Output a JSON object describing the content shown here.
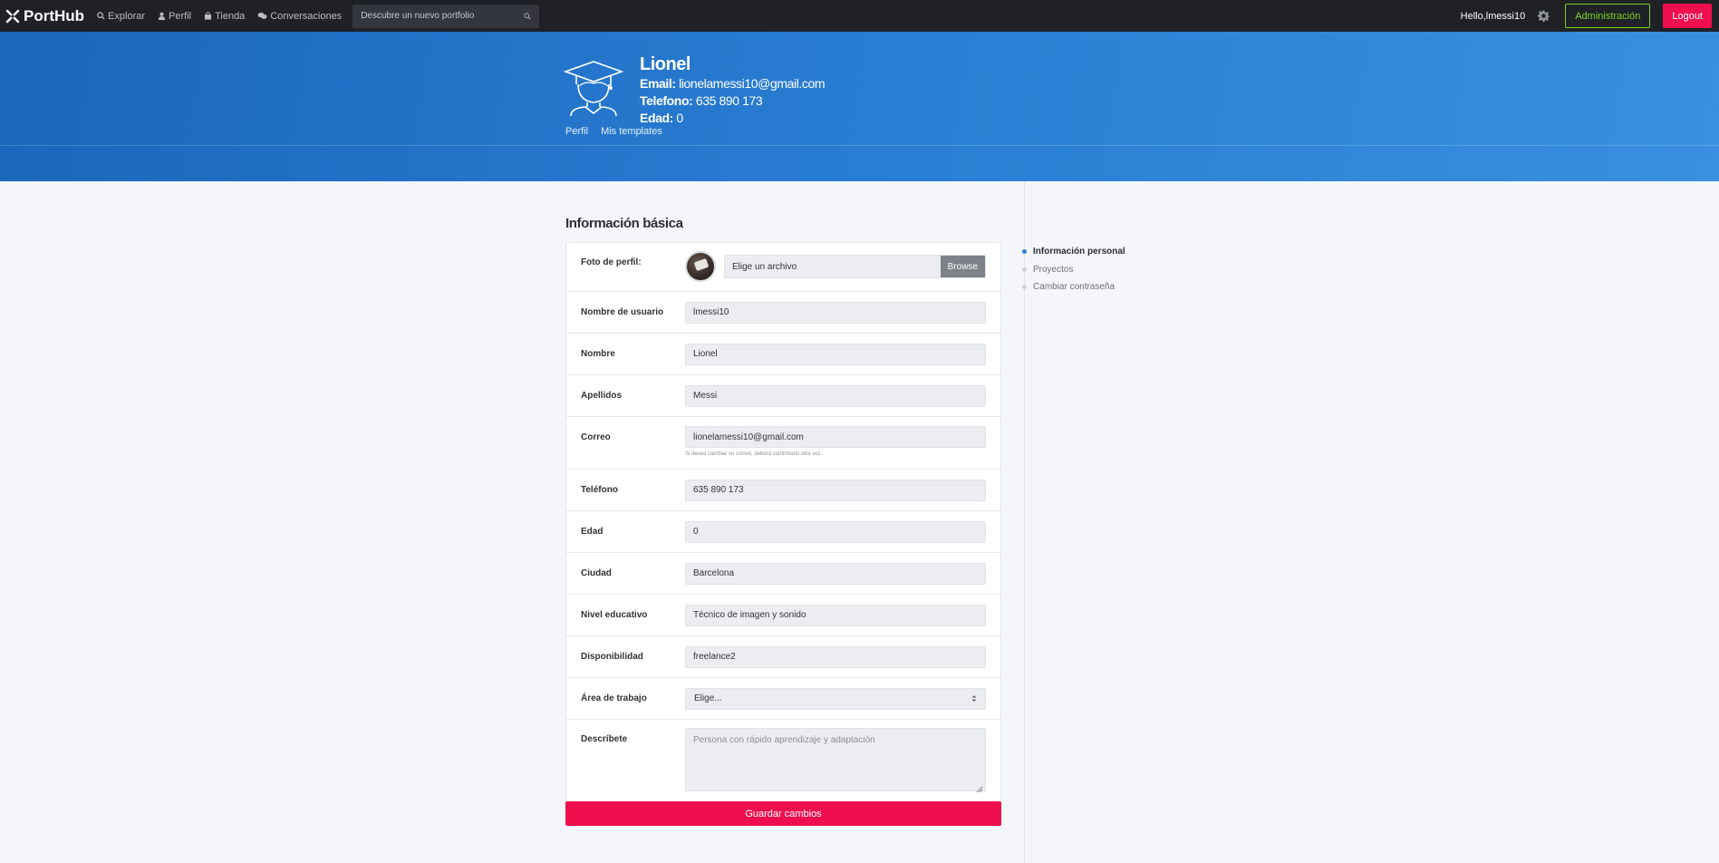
{
  "nav": {
    "brand": "PortHub",
    "links": [
      {
        "label": "Explorar",
        "icon": "search-icon"
      },
      {
        "label": "Perfil",
        "icon": "user-icon"
      },
      {
        "label": "Tienda",
        "icon": "bag-icon"
      },
      {
        "label": "Conversaciones",
        "icon": "chat-icon"
      }
    ],
    "search_placeholder": "Descubre un nuevo portfolio",
    "greeting": "Hello,lmessi10",
    "admin_label": "Administración",
    "logout_label": "Logout"
  },
  "profile": {
    "name": "Lionel",
    "email_label": "Email:",
    "email": "lionelamessi10@gmail.com",
    "phone_label": "Telefono:",
    "phone": "635 890 173",
    "age_label": "Edad:",
    "age": "0"
  },
  "subnav": [
    "Perfil",
    "Mis templates"
  ],
  "form": {
    "title": "Información básica",
    "photo_label": "Foto de perfil:",
    "file_placeholder": "Elige un archivo",
    "browse_label": "Browse",
    "fields": [
      {
        "label": "Nombre de usuario",
        "value": "lmessi10"
      },
      {
        "label": "Nombre",
        "value": "Lionel"
      },
      {
        "label": "Apellidos",
        "value": "Messi"
      },
      {
        "label": "Correo",
        "value": "lionelamessi10@gmail.com",
        "hint": "Si desea cambiar su correo, deberá confirmarlo otra vez."
      },
      {
        "label": "Teléfono",
        "value": "635 890 173"
      },
      {
        "label": "Edad",
        "value": "0"
      },
      {
        "label": "Ciudad",
        "value": "Barcelona"
      },
      {
        "label": "Nivel educativo",
        "value": "Técnico de imagen y sonido"
      },
      {
        "label": "Disponibilidad",
        "value": "freelance2"
      }
    ],
    "area_label": "Área de trabajo",
    "area_value": "Elige...",
    "describe_label": "Descríbete",
    "describe_placeholder": "Persona con rápido aprendizaje y adaptación",
    "save_label": "Guardar cambios"
  },
  "side_nav": [
    {
      "label": "Información personal",
      "active": true
    },
    {
      "label": "Proyectos",
      "active": false
    },
    {
      "label": "Cambiar contraseña",
      "active": false
    }
  ],
  "colors": {
    "accent": "#ef0f4e",
    "hero": "#2a7fd4",
    "admin": "#7ed321",
    "topbar": "#1f2126"
  }
}
